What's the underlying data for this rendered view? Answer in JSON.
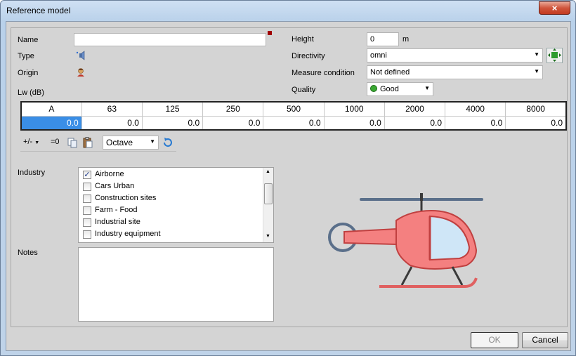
{
  "window": {
    "title": "Reference model",
    "close_label": "×"
  },
  "left": {
    "name_label": "Name",
    "name_value": "",
    "type_label": "Type",
    "origin_label": "Origin",
    "lw_label": "Lw (dB)"
  },
  "right": {
    "height_label": "Height",
    "height_value": "0",
    "height_unit": "m",
    "directivity_label": "Directivity",
    "directivity_value": "omni",
    "measure_label": "Measure condition",
    "measure_value": "Not defined",
    "quality_label": "Quality",
    "quality_value": "Good"
  },
  "lw_table": {
    "headers": [
      "A",
      "63",
      "125",
      "250",
      "500",
      "1000",
      "2000",
      "4000",
      "8000"
    ],
    "values": [
      "0.0",
      "0.0",
      "0.0",
      "0.0",
      "0.0",
      "0.0",
      "0.0",
      "0.0",
      "0.0"
    ]
  },
  "toolbar": {
    "plusminus": "+/-",
    "equal_zero": "=0",
    "band": "Octave"
  },
  "industry": {
    "label": "Industry",
    "items": [
      {
        "label": "Airborne",
        "checked": "✓"
      },
      {
        "label": "Cars Urban",
        "checked": ""
      },
      {
        "label": "Construction sites",
        "checked": ""
      },
      {
        "label": "Farm - Food",
        "checked": ""
      },
      {
        "label": "Industrial site",
        "checked": ""
      },
      {
        "label": "Industry equipment",
        "checked": ""
      }
    ]
  },
  "notes": {
    "label": "Notes",
    "value": ""
  },
  "buttons": {
    "ok": "OK",
    "cancel": "Cancel"
  },
  "icons": {
    "type": "speaker-icon",
    "origin": "user-icon",
    "directivity_view": "move-icon",
    "refresh": "refresh-icon",
    "copy": "copy-icon",
    "paste": "paste-icon",
    "illustration": "helicopter-illustration"
  },
  "colors": {
    "selection": "#3a8ee6",
    "quality_dot": "#3aa832",
    "heli_body": "#f48080"
  }
}
